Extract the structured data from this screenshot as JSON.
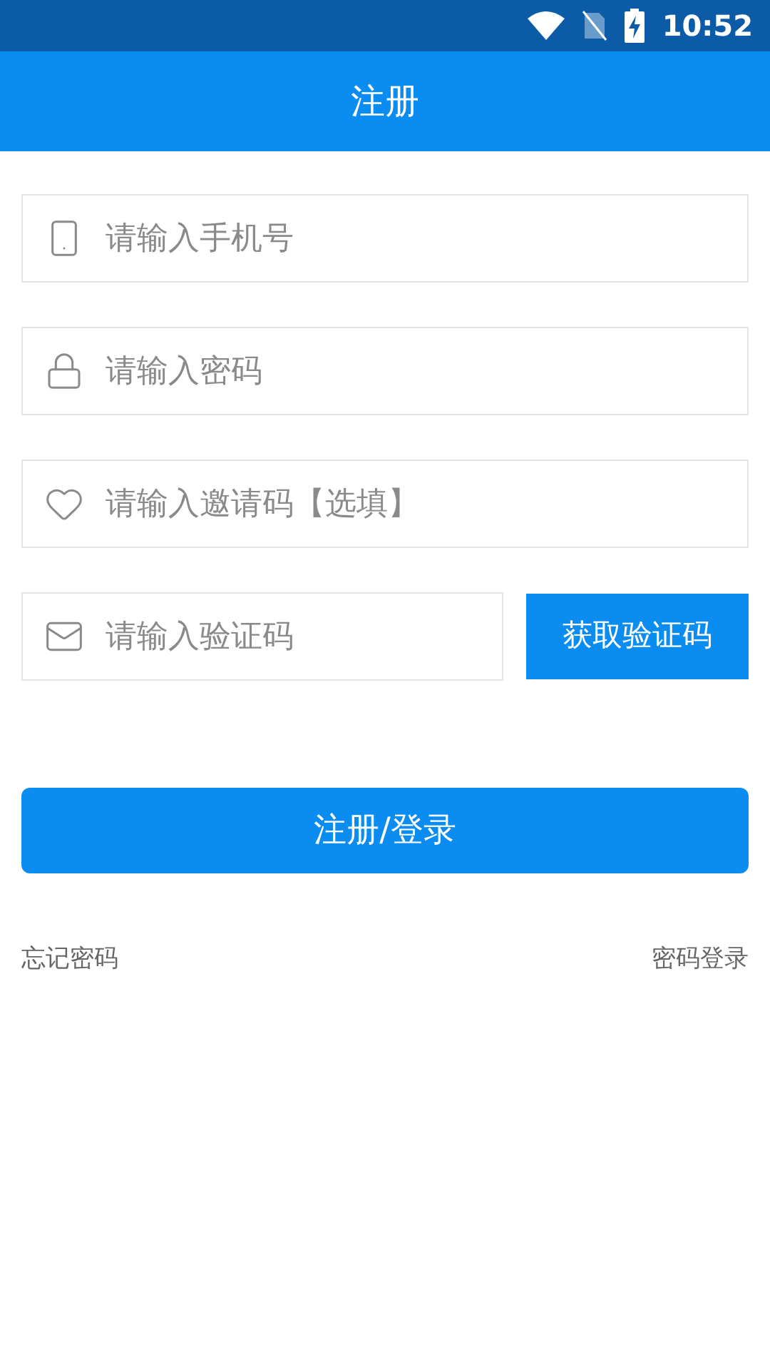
{
  "status_bar": {
    "time": "10:52"
  },
  "header": {
    "title": "注册"
  },
  "fields": [
    {
      "kind": "phone",
      "placeholder": "请输入手机号"
    },
    {
      "kind": "password",
      "placeholder": "请输入密码"
    },
    {
      "kind": "invite",
      "placeholder": "请输入邀请码【选填】"
    },
    {
      "kind": "code",
      "placeholder": "请输入验证码"
    }
  ],
  "code_button": "获取验证码",
  "submit_button": "注册/登录",
  "links": [
    "忘记密码",
    "密码登录"
  ]
}
